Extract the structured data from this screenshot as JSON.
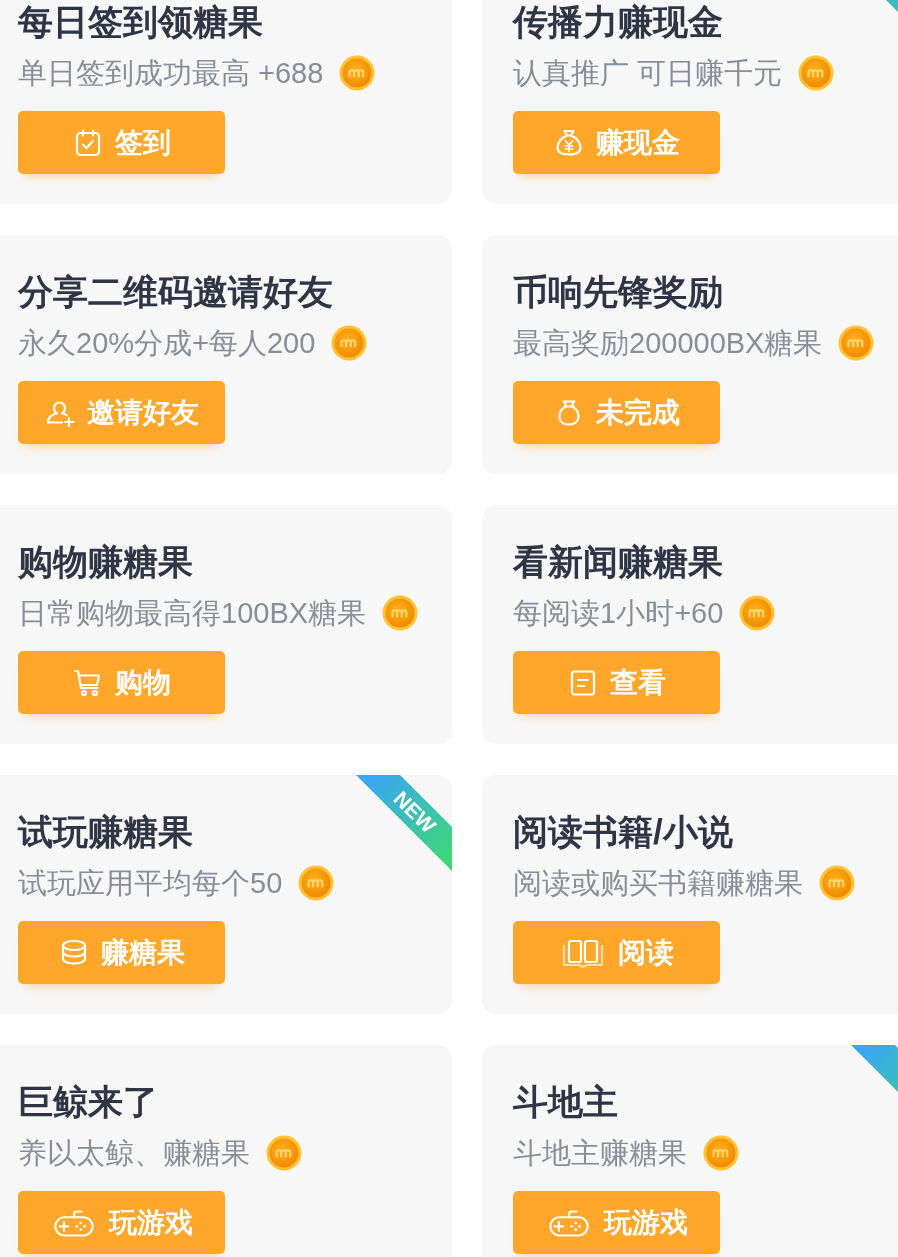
{
  "cards": [
    {
      "kind": "checkin",
      "title": "每日签到领糖果",
      "subtitle": "单日签到成功最高 +688",
      "button": "签到",
      "new_ribbon": false
    },
    {
      "kind": "cash",
      "title": "传播力赚现金",
      "subtitle": "认真推广 可日赚千元",
      "button": "赚现金",
      "new_ribbon": true
    },
    {
      "kind": "invite",
      "title": "分享二维码邀请好友",
      "subtitle": "永久20%分成+每人200",
      "button": "邀请好友",
      "new_ribbon": false
    },
    {
      "kind": "reward",
      "title": "币响先锋奖励",
      "subtitle": "最高奖励200000BX糖果",
      "button": "未完成",
      "new_ribbon": false
    },
    {
      "kind": "shop",
      "title": "购物赚糖果",
      "subtitle": "日常购物最高得100BX糖果",
      "button": "购物",
      "new_ribbon": false
    },
    {
      "kind": "news",
      "title": "看新闻赚糖果",
      "subtitle": "每阅读1小时+60",
      "button": "查看",
      "new_ribbon": false
    },
    {
      "kind": "trial",
      "title": "试玩赚糖果",
      "subtitle": "试玩应用平均每个50",
      "button": "赚糖果",
      "new_ribbon": true,
      "ribbon_label": "NEW"
    },
    {
      "kind": "reading",
      "title": "阅读书籍/小说",
      "subtitle": "阅读或购买书籍赚糖果",
      "button": "阅读",
      "new_ribbon": false
    },
    {
      "kind": "game",
      "title": "巨鲸来了",
      "subtitle": "养以太鲸、赚糖果",
      "button": "玩游戏",
      "new_ribbon": false
    },
    {
      "kind": "game",
      "title": "斗地主",
      "subtitle": "斗地主赚糖果",
      "button": "玩游戏",
      "new_ribbon": true
    }
  ]
}
